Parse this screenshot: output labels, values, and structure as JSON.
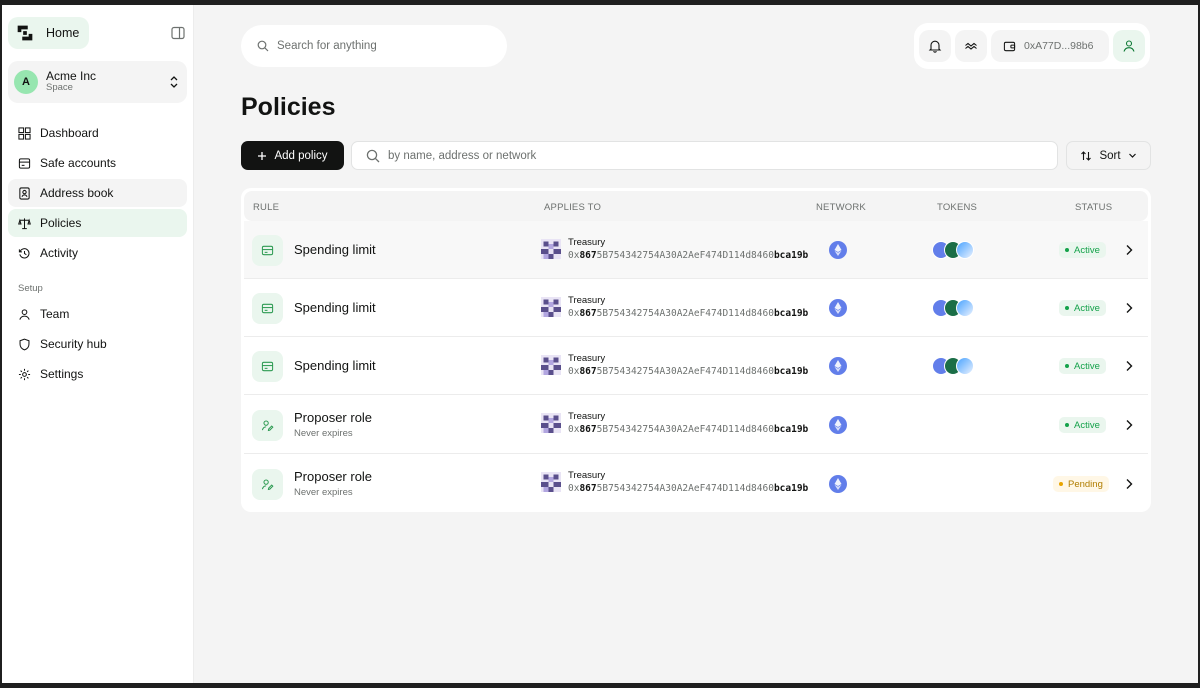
{
  "sidebar": {
    "home_label": "Home",
    "space": {
      "initial": "A",
      "name": "Acme Inc",
      "type": "Space"
    },
    "nav": [
      {
        "label": "Dashboard",
        "icon": "grid-icon"
      },
      {
        "label": "Safe accounts",
        "icon": "wallet-icon"
      },
      {
        "label": "Address book",
        "icon": "address-book-icon"
      },
      {
        "label": "Policies",
        "icon": "scales-icon"
      },
      {
        "label": "Activity",
        "icon": "history-icon"
      }
    ],
    "section_label": "Setup",
    "setup_nav": [
      {
        "label": "Team",
        "icon": "user-icon"
      },
      {
        "label": "Security hub",
        "icon": "shield-icon"
      },
      {
        "label": "Settings",
        "icon": "gear-icon"
      }
    ]
  },
  "header": {
    "search_placeholder": "Search for anything",
    "wallet_address": "0xA77D...98b6"
  },
  "page": {
    "title": "Policies",
    "add_label": "Add policy",
    "filter_placeholder": "by name, address or network",
    "sort_label": "Sort"
  },
  "table": {
    "headers": {
      "rule": "RULE",
      "applies": "APPLIES TO",
      "network": "NETWORK",
      "tokens": "TOKENS",
      "status": "STATUS"
    },
    "rows": [
      {
        "title": "Spending limit",
        "subtitle": "",
        "account": "Treasury",
        "addr_pre": "0x",
        "addr_bold1": "867",
        "addr_mid": "5B754342754A30A2AeF474D114d8460",
        "addr_bold2": "bca19b",
        "status": "Active",
        "tokens": true
      },
      {
        "title": "Spending limit",
        "subtitle": "",
        "account": "Treasury",
        "addr_pre": "0x",
        "addr_bold1": "867",
        "addr_mid": "5B754342754A30A2AeF474D114d8460",
        "addr_bold2": "bca19b",
        "status": "Active",
        "tokens": true
      },
      {
        "title": "Spending limit",
        "subtitle": "",
        "account": "Treasury",
        "addr_pre": "0x",
        "addr_bold1": "867",
        "addr_mid": "5B754342754A30A2AeF474D114d8460",
        "addr_bold2": "bca19b",
        "status": "Active",
        "tokens": true
      },
      {
        "title": "Proposer role",
        "subtitle": "Never expires",
        "account": "Treasury",
        "addr_pre": "0x",
        "addr_bold1": "867",
        "addr_mid": "5B754342754A30A2AeF474D114d8460",
        "addr_bold2": "bca19b",
        "status": "Active",
        "tokens": false
      },
      {
        "title": "Proposer role",
        "subtitle": "Never expires",
        "account": "Treasury",
        "addr_pre": "0x",
        "addr_bold1": "867",
        "addr_mid": "5B754342754A30A2AeF474D114d8460",
        "addr_bold2": "bca19b",
        "status": "Pending",
        "tokens": false
      }
    ]
  },
  "colors": {
    "accent": "#eaf6ee",
    "active": "#14a24a",
    "pending": "#e8a400",
    "eth": "#627eea"
  }
}
